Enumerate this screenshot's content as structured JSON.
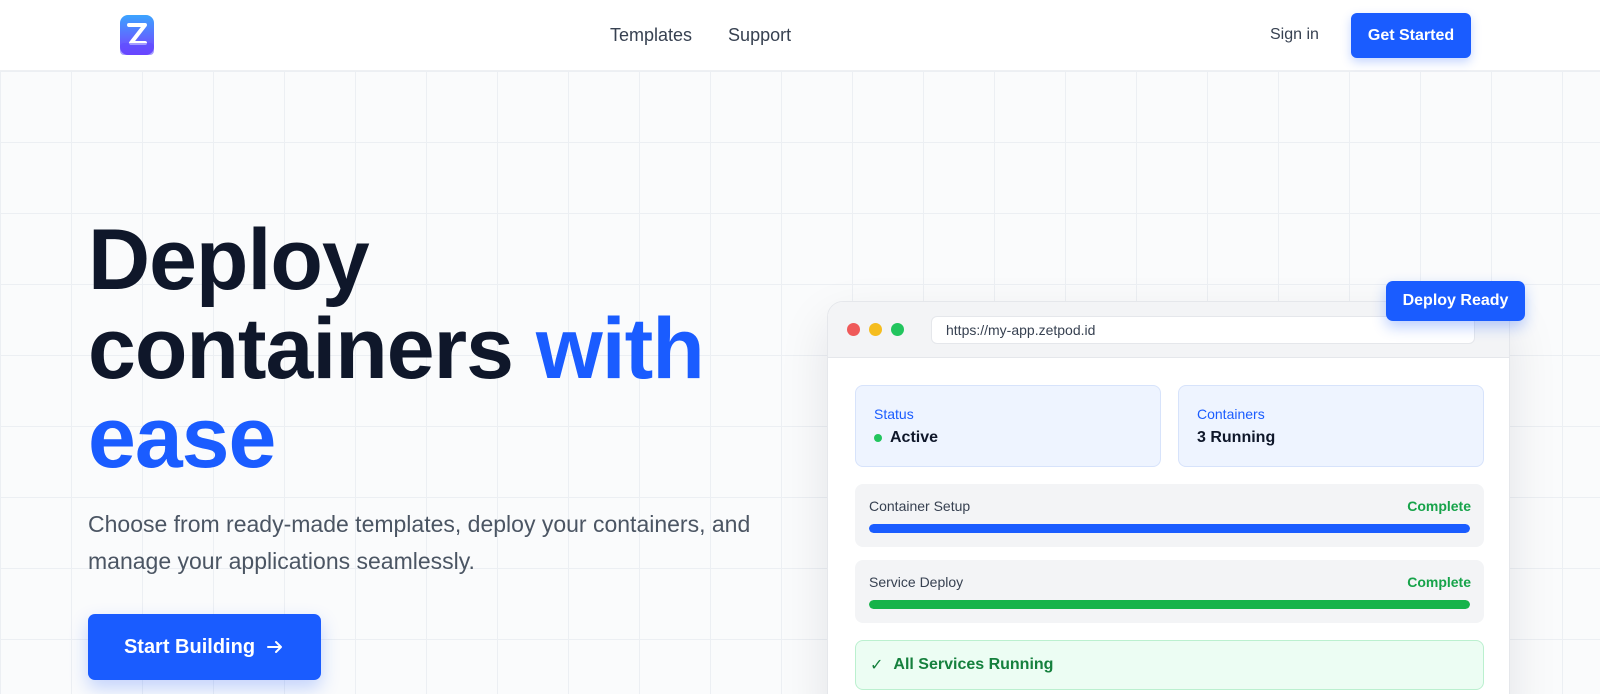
{
  "header": {
    "nav": [
      "Templates",
      "Support"
    ],
    "sign_in": "Sign in",
    "cta": "Get Started"
  },
  "hero": {
    "title_line1": "Deploy",
    "title_line2": "containers ",
    "title_accent1": "with",
    "title_accent2": "ease",
    "subtitle": "Choose from ready-made templates, deploy your containers, and manage your applications seamlessly.",
    "cta": "Start Building"
  },
  "preview": {
    "badge": "Deploy Ready",
    "url": "https://my-app.zetpod.id",
    "status_label": "Status",
    "status_value": "Active",
    "containers_label": "Containers",
    "containers_value": "3 Running",
    "steps": [
      {
        "label": "Container Setup",
        "status": "Complete",
        "progress": 1.0
      },
      {
        "label": "Service Deploy",
        "status": "Complete",
        "progress": 1.0
      }
    ],
    "running_check": "✓",
    "running_text": "All Services Running"
  },
  "colors": {
    "accent": "#1a5cff",
    "success": "#16a34a"
  },
  "icons": {
    "logo": "z-logo-icon",
    "arrow": "arrow-right-icon"
  }
}
